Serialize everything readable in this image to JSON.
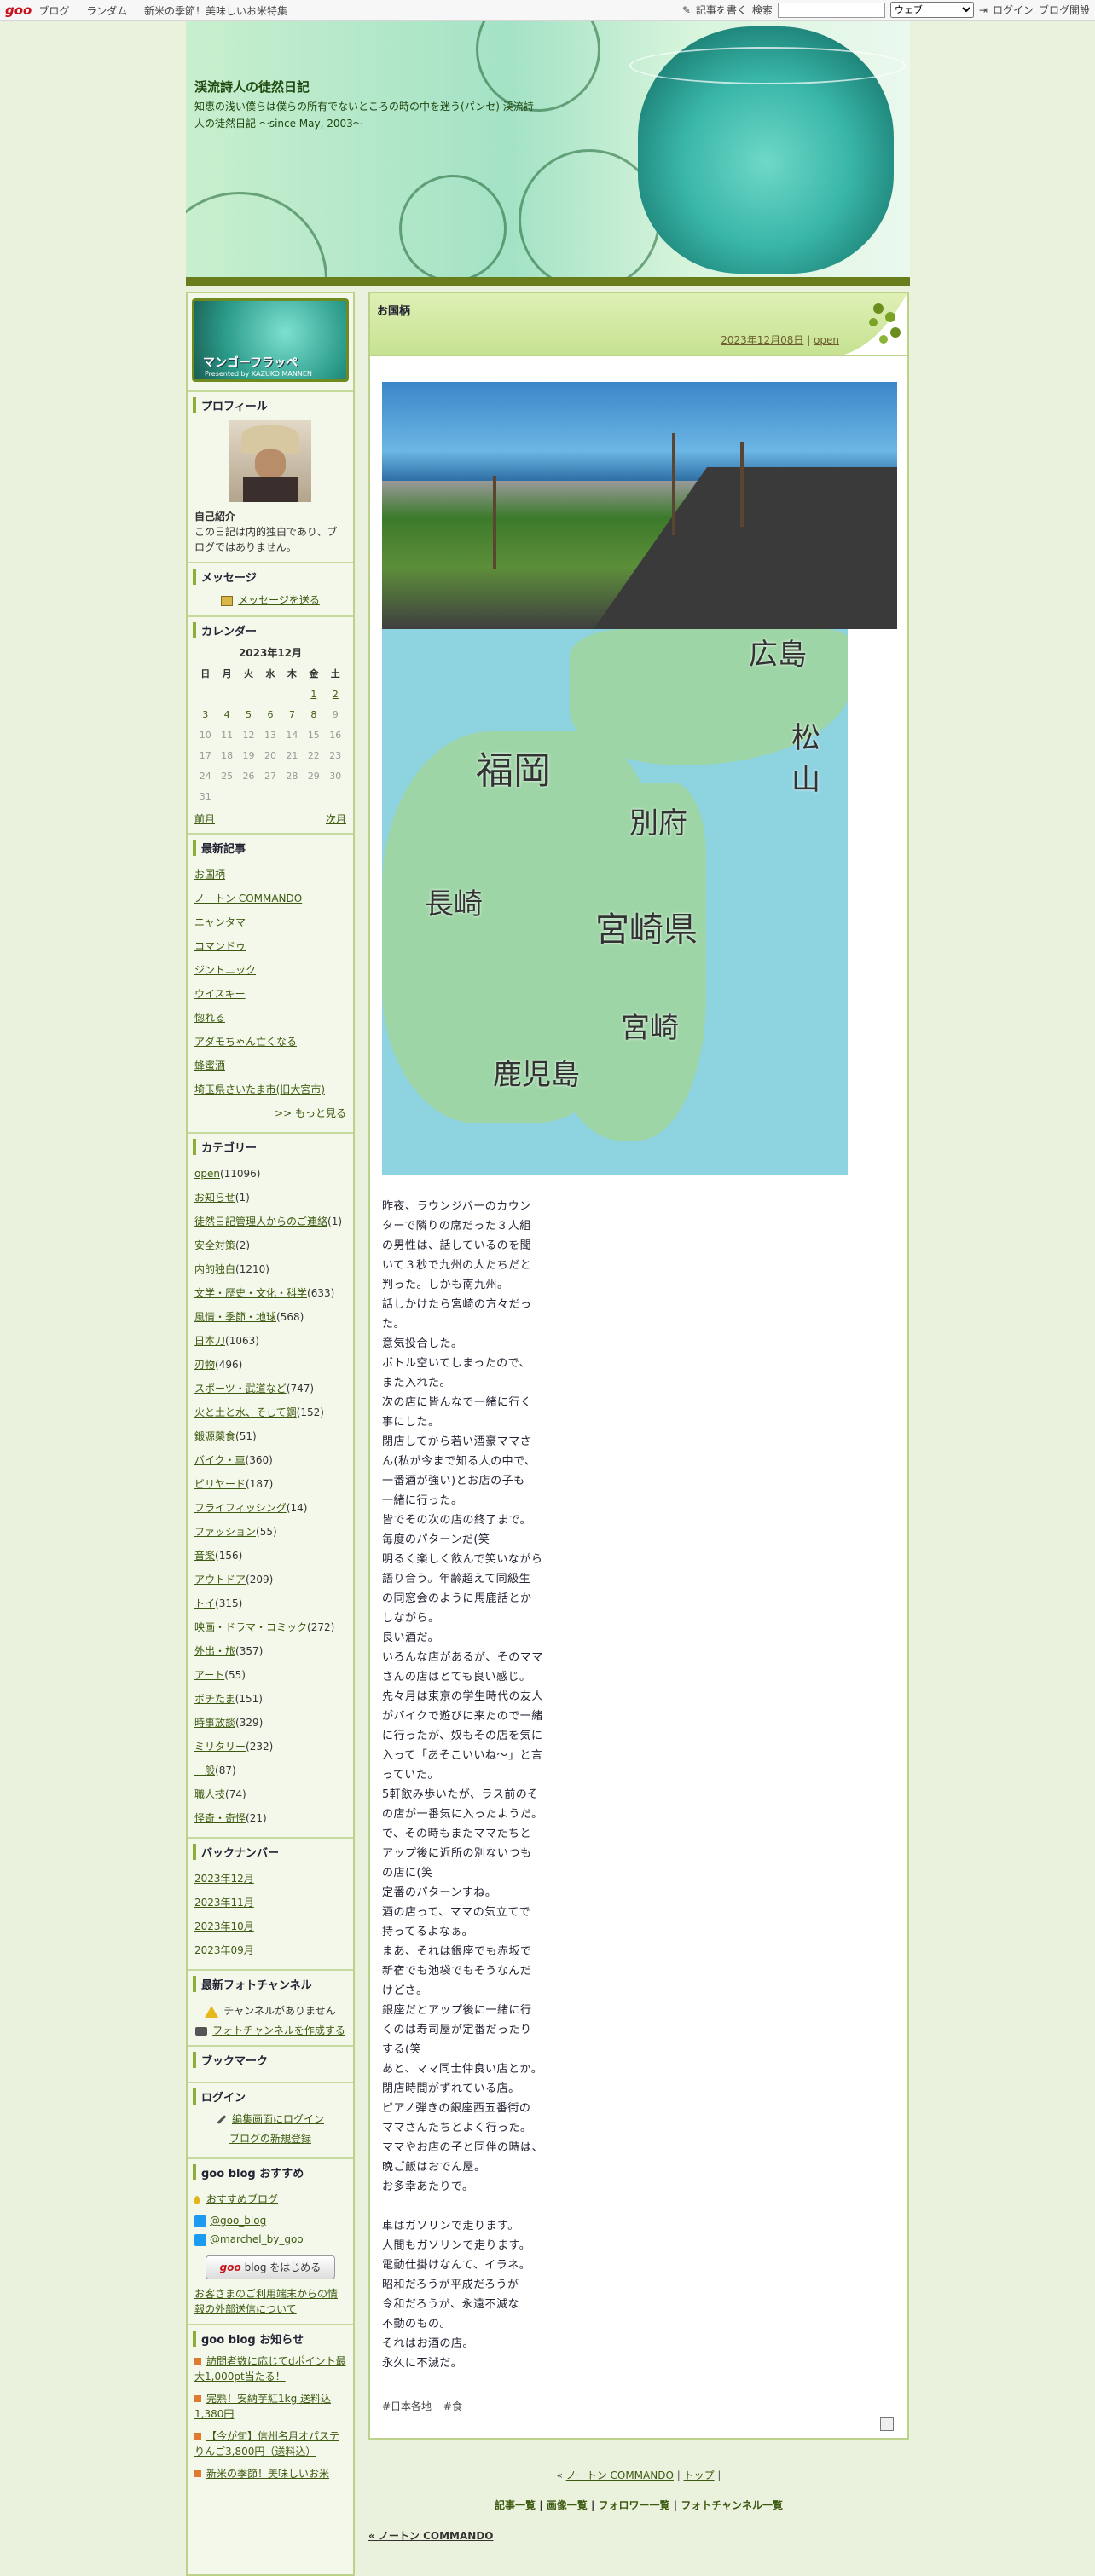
{
  "topbar": {
    "logo": "goo",
    "nav": [
      "ブログ",
      "ランダム",
      "新米の季節！美味しいお米特集"
    ],
    "write": "記事を書く",
    "search_label": "検索",
    "search_value": "",
    "scope": "ウェブ",
    "login": "ログイン",
    "start": "ブログ開設"
  },
  "header": {
    "title": "渓流詩人の徒然日記",
    "desc": "知恵の浅い僕らは僕らの所有でないところの時の中を迷う(パンセ) 渓流詩人の徒然日記 〜since May, 2003〜"
  },
  "sidebar": {
    "banner_title": "マンゴーフラッペ",
    "banner_sub": "Presented by KAZUKO MANNEN",
    "profile": {
      "title": "プロフィール",
      "intro_title": "自己紹介",
      "intro": "この日記は内的独白であり、ブログではありません。"
    },
    "message": {
      "title": "メッセージ",
      "link": "メッセージを送る"
    },
    "calendar": {
      "title": "カレンダー",
      "month": "2023年12月",
      "weekdays": [
        "日",
        "月",
        "火",
        "水",
        "木",
        "金",
        "土"
      ],
      "prev": "前月",
      "next": "次月"
    },
    "recent": {
      "title": "最新記事",
      "items": [
        "お国柄",
        "ノートン COMMANDO",
        "ニャンタマ",
        "コマンドゥ",
        "ジントニック",
        "ウイスキー",
        "惚れる",
        "アダモちゃん亡くなる",
        "蜂蜜酒",
        "埼玉県さいたま市(旧大宮市)"
      ],
      "more": ">> もっと見る"
    },
    "category": {
      "title": "カテゴリー",
      "items": [
        {
          "name": "open",
          "count": "(11096)"
        },
        {
          "name": "お知らせ",
          "count": "(1)"
        },
        {
          "name": "徒然日記管理人からのご連絡",
          "count": "(1)"
        },
        {
          "name": "安全対策",
          "count": "(2)"
        },
        {
          "name": "内的独白",
          "count": "(1210)"
        },
        {
          "name": "文学・歴史・文化・科学",
          "count": "(633)"
        },
        {
          "name": "風情・季節・地球",
          "count": "(568)"
        },
        {
          "name": "日本刀",
          "count": "(1063)"
        },
        {
          "name": "刃物",
          "count": "(496)"
        },
        {
          "name": "スポーツ・武道など",
          "count": "(747)"
        },
        {
          "name": "火と土と水、そして鋼",
          "count": "(152)"
        },
        {
          "name": "鍛源薬食",
          "count": "(51)"
        },
        {
          "name": "バイク・車",
          "count": "(360)"
        },
        {
          "name": "ビリヤード",
          "count": "(187)"
        },
        {
          "name": "フライフィッシング",
          "count": "(14)"
        },
        {
          "name": "ファッション",
          "count": "(55)"
        },
        {
          "name": "音楽",
          "count": "(156)"
        },
        {
          "name": "アウトドア",
          "count": "(209)"
        },
        {
          "name": "トイ",
          "count": "(315)"
        },
        {
          "name": "映画・ドラマ・コミック",
          "count": "(272)"
        },
        {
          "name": "外出・旅",
          "count": "(357)"
        },
        {
          "name": "アート",
          "count": "(55)"
        },
        {
          "name": "ボチたま",
          "count": "(151)"
        },
        {
          "name": "時事放談",
          "count": "(329)"
        },
        {
          "name": "ミリタリー",
          "count": "(232)"
        },
        {
          "name": "一般",
          "count": "(87)"
        },
        {
          "name": "職人技",
          "count": "(74)"
        },
        {
          "name": "怪奇・奇怪",
          "count": "(21)"
        }
      ]
    },
    "backnumber": {
      "title": "バックナンバー",
      "items": [
        "2023年12月",
        "2023年11月",
        "2023年10月",
        "2023年09月"
      ]
    },
    "photo": {
      "title": "最新フォトチャンネル",
      "none": "チャンネルがありません",
      "create": "フォトチャンネルを作成する"
    },
    "bookmark": {
      "title": "ブックマーク"
    },
    "login": {
      "title": "ログイン",
      "edit": "編集画面にログイン",
      "new": "ブログの新規登録"
    },
    "goo_reco": {
      "title": "goo blog おすすめ",
      "reco": "おすすめブログ",
      "tw1": "@goo_blog",
      "tw2": "@marchel_by_goo",
      "start_brand": "goo",
      "start_text": "blog をはじめる",
      "info": "お客さまのご利用端末からの情報の外部送信について"
    },
    "goo_news": {
      "title": "goo blog お知らせ",
      "items": [
        "訪問者数に応じてdポイント最大1,000pt当たる！",
        "完熟！安納芋紅1kg 送料込1,380円",
        "【今が旬】信州名月オパステりんご3,800円（送料込）",
        "新米の季節！美味しいお米"
      ]
    }
  },
  "main": {
    "title": "お国柄",
    "date": "2023年12月08日",
    "category": "open",
    "map_labels": [
      "広島",
      "松山",
      "福岡",
      "別府",
      "長崎",
      "宮崎県",
      "宮崎",
      "鹿児島"
    ],
    "body": [
      "昨夜、ラウンジバーのカウン",
      "ターで隣りの席だった３人組",
      "の男性は、話しているのを聞",
      "いて３秒で九州の人たちだと",
      "判った。しかも南九州。",
      "話しかけたら宮崎の方々だっ",
      "た。",
      "意気投合した。",
      "ボトル空いてしまったので、",
      "また入れた。",
      "次の店に皆んなで一緒に行く",
      "事にした。",
      "閉店してから若い酒豪ママさ",
      "ん(私が今まで知る人の中で、",
      "一番酒が強い)とお店の子も",
      "一緒に行った。",
      "皆でその次の店の終了まで。",
      "毎度のパターンだ(笑",
      "明るく楽しく飲んで笑いながら",
      "語り合う。年齢超えて同級生",
      "の同窓会のように馬鹿話とか",
      "しながら。",
      "良い酒だ。",
      "いろんな店があるが、そのママ",
      "さんの店はとても良い感じ。",
      "先々月は東京の学生時代の友人",
      "がバイクで遊びに来たので一緒",
      "に行ったが、奴もその店を気に",
      "入って「あそこいいね〜」と言",
      "っていた。",
      "5軒飲み歩いたが、ラス前のそ",
      "の店が一番気に入ったようだ。",
      "で、その時もまたママたちと",
      "アップ後に近所の別ないつも",
      "の店に(笑",
      "定番のパターンすね。",
      "酒の店って、ママの気立てで",
      "持ってるよなぁ。",
      "まあ、それは銀座でも赤坂で",
      "新宿でも池袋でもそうなんだ",
      "けどさ。",
      "銀座だとアップ後に一緒に行",
      "くのは寿司屋が定番だったり",
      "する(笑",
      "あと、ママ同士仲良い店とか。",
      "閉店時間がずれている店。",
      "ピアノ弾きの銀座西五番街の",
      "ママさんたちとよく行った。",
      "ママやお店の子と同伴の時は、",
      "晩ご飯はおでん屋。",
      "お多幸あたりで。",
      "",
      "車はガソリンで走ります。",
      "人間もガソリンで走ります。",
      "電動仕掛けなんて、イラネ。",
      "昭和だろうが平成だろうが",
      "令和だろうが、永遠不滅な",
      "不動のもの。",
      "それはお酒の店。",
      "永久に不滅だ。"
    ],
    "tags": [
      "#日本各地",
      "#食"
    ]
  },
  "footer": {
    "prev_post": "ノートン COMMANDO",
    "top": "トップ",
    "links": [
      "記事一覧",
      "画像一覧",
      "フォロワー一覧",
      "フォトチャンネル一覧"
    ],
    "back": "« ノートン COMMANDO"
  }
}
